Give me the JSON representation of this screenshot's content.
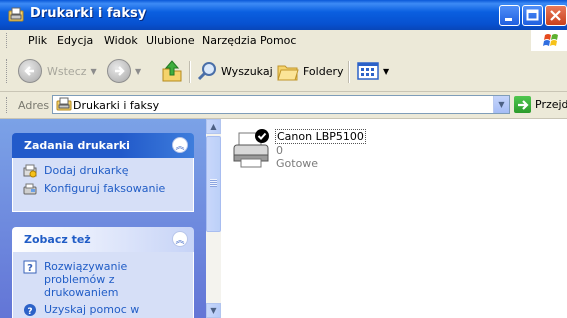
{
  "window": {
    "title": "Drukarki i faksy"
  },
  "menu": {
    "items": [
      "Plik",
      "Edycja",
      "Widok",
      "Ulubione",
      "Narzędzia",
      "Pomoc"
    ]
  },
  "toolbar": {
    "back_label": "Wstecz",
    "search_label": "Wyszukaj",
    "folders_label": "Foldery"
  },
  "address": {
    "label": "Adres",
    "value": "Drukarki i faksy",
    "go_label": "Przejdź"
  },
  "taskpane": {
    "printer_tasks": {
      "title": "Zadania drukarki",
      "items": [
        "Dodaj drukarkę",
        "Konfiguruj faksowanie"
      ]
    },
    "see_also": {
      "title": "Zobacz też",
      "items": [
        "Rozwiązywanie problemów z drukowaniem",
        "Uzyskaj pomoc w"
      ]
    }
  },
  "printers": [
    {
      "name": "Canon LBP5100",
      "jobs": "0",
      "status": "Gotowe"
    }
  ],
  "colors": {
    "titlebar": "#0a5fe0",
    "taskpane_bg": "#6f8fe0",
    "panel_header": "#225aca",
    "link": "#215dc6"
  }
}
